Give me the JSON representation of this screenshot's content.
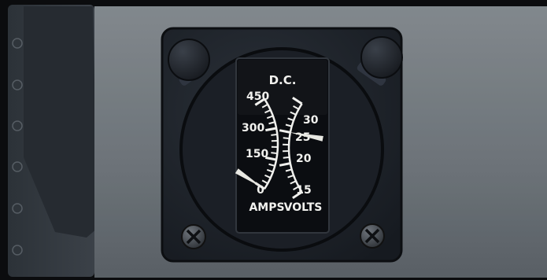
{
  "gauge": {
    "title": "D.C.",
    "amps": {
      "label": "AMPS",
      "ticks": [
        "0",
        "150",
        "300",
        "450"
      ],
      "min": 0,
      "max": 450,
      "reading": 0
    },
    "volts": {
      "label": "VOLTS",
      "ticks": [
        "15",
        "20",
        "25",
        "30"
      ],
      "min": 15,
      "max": 30,
      "reading": 25
    }
  },
  "icons": {
    "screw_left": "phillips-screw-icon",
    "screw_right": "phillips-screw-icon",
    "knob_left": "retaining-knob-icon",
    "knob_right": "retaining-knob-icon"
  },
  "colors": {
    "panel": "#7c8388",
    "bezel": "#1d2229",
    "face": "#0b0d11",
    "markings": "#f1f1ee"
  }
}
